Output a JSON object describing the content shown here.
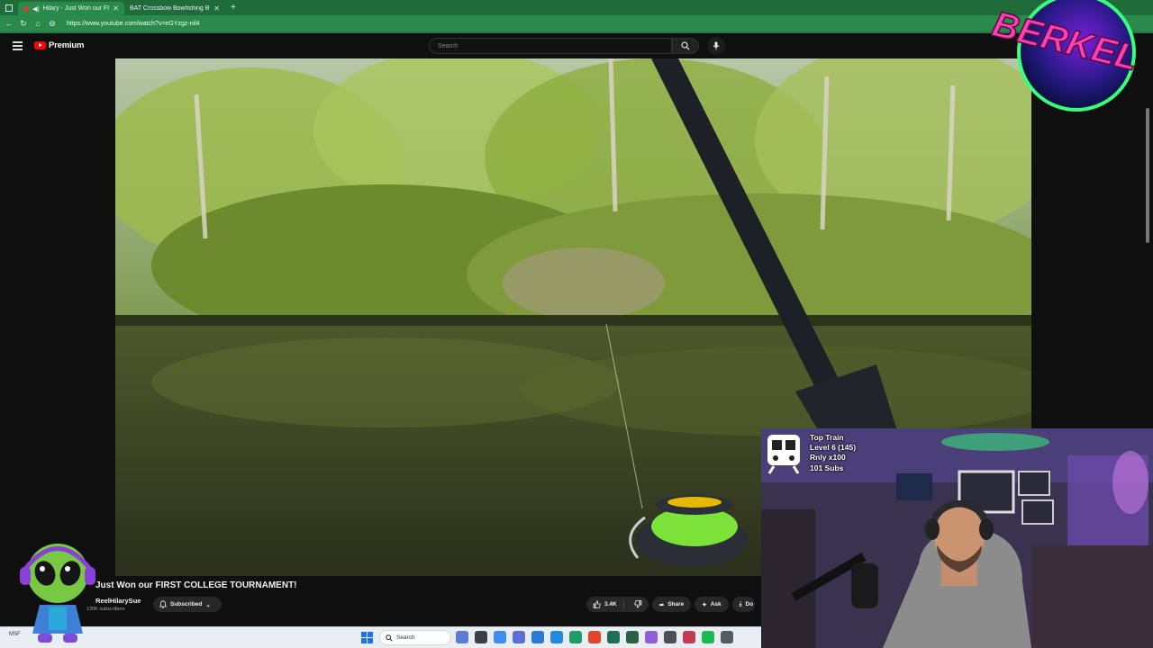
{
  "browser": {
    "tabs": [
      {
        "title": "Hilary - Just Won our FIRST",
        "active": true
      },
      {
        "title": "BAT Crossbow Bowfishing Bundle",
        "active": false
      }
    ],
    "url": "https://www.youtube.com/watch?v=eGYzgz-nil4"
  },
  "youtube": {
    "brand": "Premium",
    "search_placeholder": "Search"
  },
  "video": {
    "title": "Just Won our FIRST COLLEGE TOURNAMENT!",
    "channel": "ReelHilarySue",
    "subscribers": "130K subscribers",
    "subscribed_label": "Subscribed",
    "likes": "3.4K",
    "share_label": "Share",
    "ask_label": "Ask",
    "download_label": "Do"
  },
  "taskbar": {
    "left_text": "MSF",
    "search_label": "Search"
  },
  "stream_overlay": {
    "logo_text": "BERKEL",
    "train": {
      "title": "Top Train",
      "level": "Level 6  (145)",
      "note": "Rnly x100",
      "subs": "101 Subs"
    }
  },
  "colors": {
    "browser_green": "#2a8a4b",
    "youtube_red": "#ff0000",
    "background": "#0f0f0f"
  }
}
